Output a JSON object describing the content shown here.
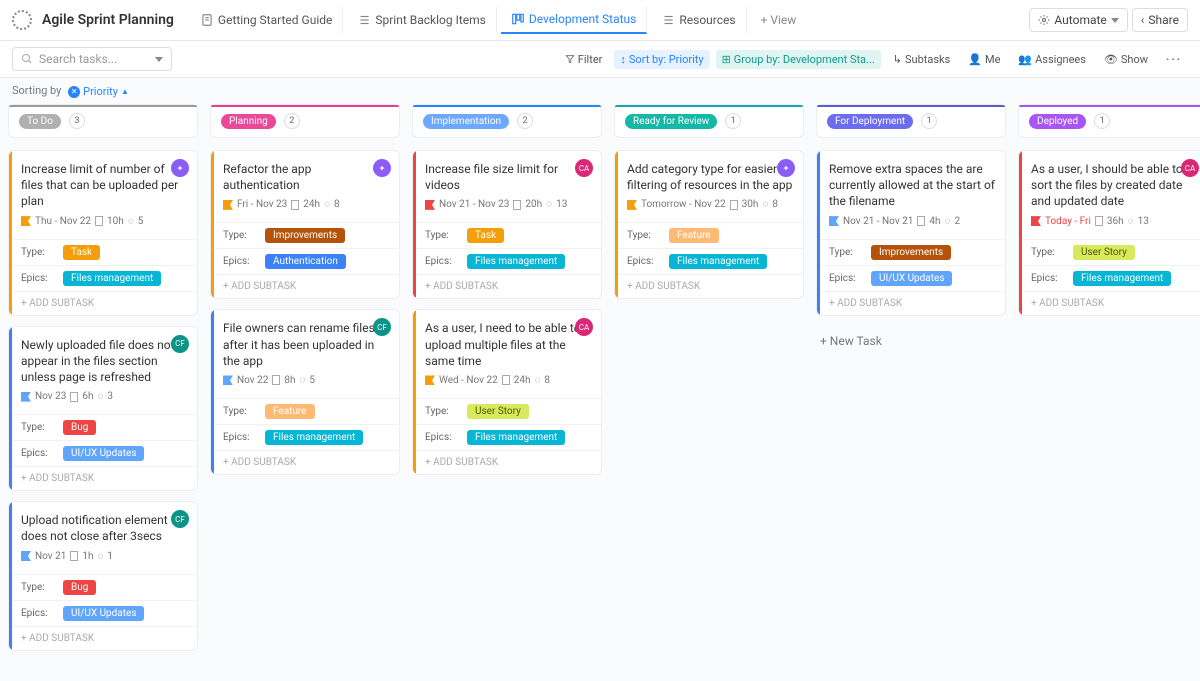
{
  "header": {
    "title": "Agile Sprint Planning",
    "tabs": [
      {
        "label": "Getting Started Guide"
      },
      {
        "label": "Sprint Backlog Items"
      },
      {
        "label": "Development Status"
      },
      {
        "label": "Resources"
      }
    ],
    "add_view": "+ View",
    "automate": "Automate",
    "share": "Share"
  },
  "toolbar": {
    "search_placeholder": "Search tasks...",
    "filter": "Filter",
    "sort": "Sort by: Priority",
    "group": "Group by: Development Sta...",
    "subtasks": "Subtasks",
    "me": "Me",
    "assignees": "Assignees",
    "show": "Show"
  },
  "sorting": {
    "label": "Sorting by",
    "chip": "Priority"
  },
  "columns": [
    {
      "name": "To Do",
      "count": "3",
      "pill": "pill-gray",
      "head": "c-gray"
    },
    {
      "name": "Planning",
      "count": "2",
      "pill": "pill-pink",
      "head": "c-pink"
    },
    {
      "name": "Implementation",
      "count": "2",
      "pill": "pill-blue",
      "head": "c-blue"
    },
    {
      "name": "Ready for Review",
      "count": "1",
      "pill": "pill-teal",
      "head": "c-teal"
    },
    {
      "name": "For Deployment",
      "count": "1",
      "pill": "pill-indigo",
      "head": "c-indigo"
    },
    {
      "name": "Deployed",
      "count": "1",
      "pill": "pill-purple",
      "head": "c-purple"
    }
  ],
  "cards": {
    "c0": {
      "title": "Increase limit of number of files that can be uploaded per plan",
      "date": "Thu  -  Nov 22",
      "est": "10h",
      "sub": "5",
      "type": "Task",
      "epic": "Files management"
    },
    "c1": {
      "title": "Newly uploaded file does not appear in the files section unless page is refreshed",
      "date": "Nov 23",
      "est": "6h",
      "sub": "3",
      "type": "Bug",
      "epic": "UI/UX Updates"
    },
    "c2": {
      "title": "Upload notification element does not close after 3secs",
      "date": "Nov 21",
      "est": "1h",
      "sub": "1",
      "type": "Bug",
      "epic": "UI/UX Updates"
    },
    "c3": {
      "title": "Refactor the app authentication",
      "date": "Fri  -  Nov 23",
      "est": "24h",
      "sub": "8",
      "type": "Improvements",
      "epic": "Authentication"
    },
    "c4": {
      "title": "File owners can rename files after it has been uploaded in the app",
      "date": "Nov 22",
      "est": "8h",
      "sub": "5",
      "type": "Feature",
      "epic": "Files management"
    },
    "c5": {
      "title": "Increase file size limit for videos",
      "date": "Nov 21  -  Nov 23",
      "est": "20h",
      "sub": "13",
      "type": "Task",
      "epic": "Files management"
    },
    "c6": {
      "title": "As a user, I need to be able to upload multiple files at the same time",
      "date": "Wed  -  Nov 22",
      "est": "24h",
      "sub": "8",
      "type": "User Story",
      "epic": "Files management"
    },
    "c7": {
      "title": "Add category type for easier filtering of resources in the app",
      "date": "Tomorrow  -  Nov 22",
      "est": "30h",
      "sub": "8",
      "type": "Feature",
      "epic": "Files management"
    },
    "c8": {
      "title": "Remove extra spaces the are currently allowed at the start of the filename",
      "date": "Nov 21  -  Nov 21",
      "est": "4h",
      "sub": "2",
      "type": "Improvements",
      "epic": "UI/UX Updates"
    },
    "c9": {
      "title": "As a user, I should be able to sort the files by created date and updated date",
      "date": "Today  -  Fri",
      "est": "36h",
      "sub": "13",
      "type": "User Story",
      "epic": "Files management"
    }
  },
  "labels": {
    "type": "Type:",
    "epics": "Epics:",
    "add_subtask": "+ ADD SUBTASK",
    "new_task": "+ New Task"
  }
}
